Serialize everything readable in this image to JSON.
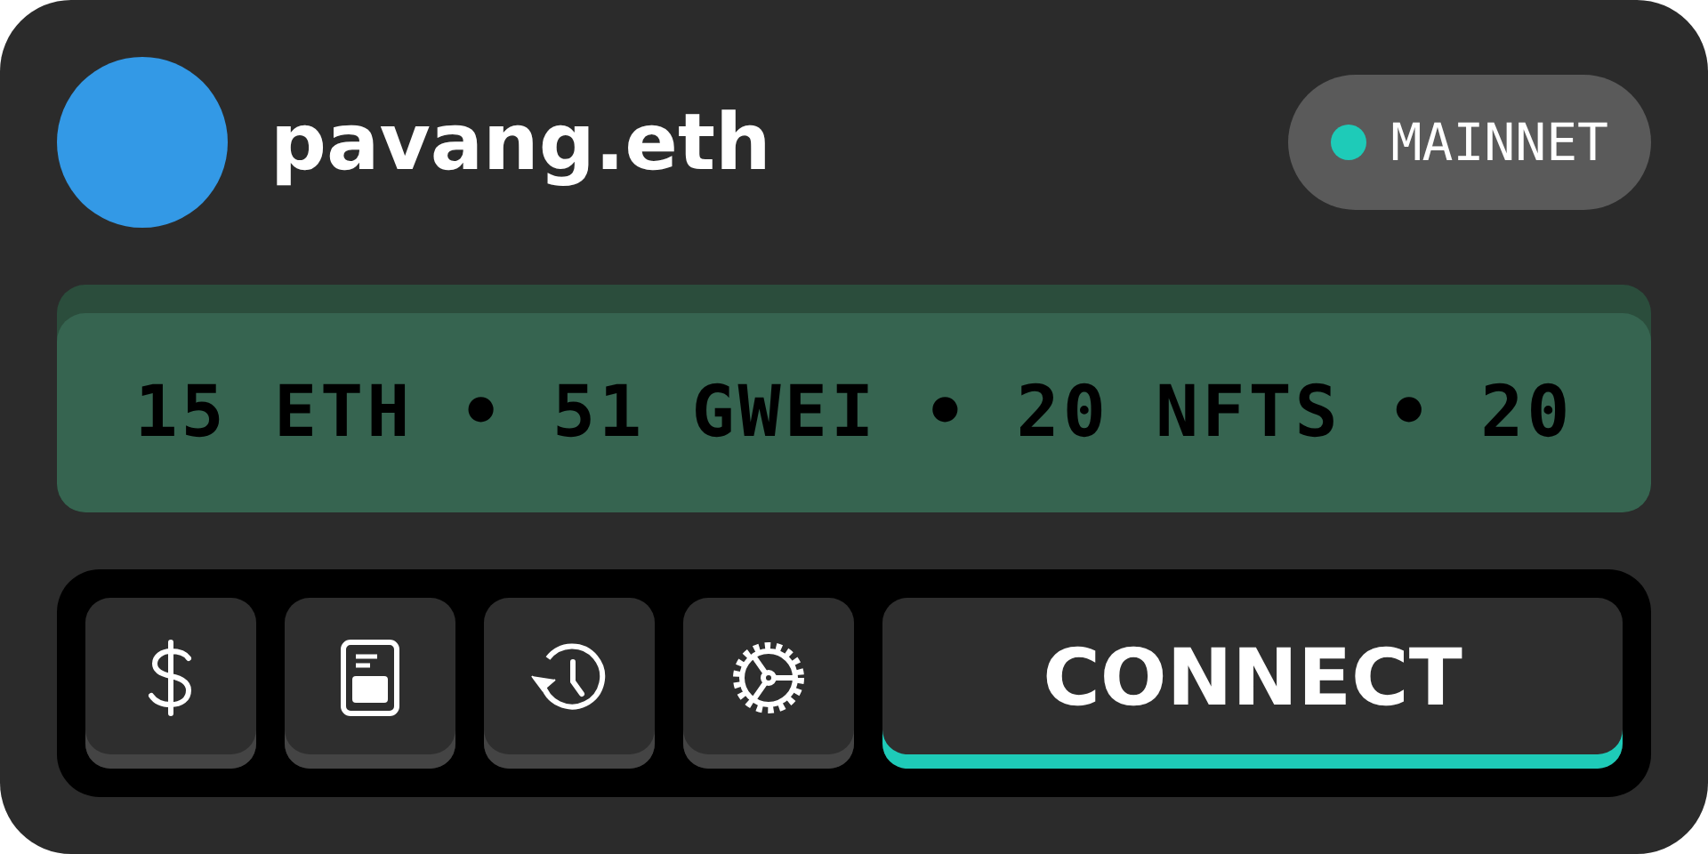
{
  "profile": {
    "name": "pavang.eth"
  },
  "network": {
    "label": "MAINNET",
    "color": "#1ecbb8"
  },
  "ticker": {
    "text": "15 ETH • 51 GWEI • 20 NFTS • 20"
  },
  "toolbar": [
    {
      "kind": "dollar"
    },
    {
      "kind": "card"
    },
    {
      "kind": "history"
    },
    {
      "kind": "settings"
    },
    {
      "kind": "connect",
      "label": "CONNECT"
    }
  ]
}
